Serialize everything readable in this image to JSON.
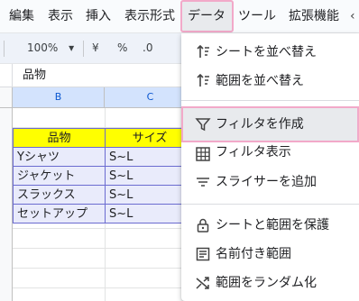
{
  "menubar": {
    "items": [
      "編集",
      "表示",
      "挿入",
      "表示形式",
      "データ",
      "ツール",
      "拡張機能"
    ],
    "active": "データ"
  },
  "toolbar": {
    "zoom": "100%",
    "currency": "¥",
    "percent": "%",
    "decimal": ".0"
  },
  "formula_bar": {
    "content": "品物"
  },
  "sheet": {
    "columns": [
      "B",
      "C"
    ],
    "table": {
      "headers": [
        "品物",
        "サイズ"
      ],
      "rows": [
        [
          "Yシャツ",
          "S~L"
        ],
        [
          "ジャケット",
          "S~L"
        ],
        [
          "スラックス",
          "S~L"
        ],
        [
          "セットアップ",
          "S~L"
        ]
      ]
    },
    "colors": {
      "header_fill": "#ffff00",
      "data_fill": "#e9ebfb",
      "border": "#6b6bd0"
    }
  },
  "data_menu": {
    "items": [
      {
        "label": "シートを並べ替え",
        "icon": "sort-icon"
      },
      {
        "label": "範囲を並べ替え",
        "icon": "sort-icon"
      },
      {
        "label": "フィルタを作成",
        "icon": "filter-icon",
        "highlighted": true
      },
      {
        "label": "フィルタ表示",
        "icon": "table-icon"
      },
      {
        "label": "スライサーを追加",
        "icon": "slicer-icon"
      },
      {
        "label": "シートと範囲を保護",
        "icon": "lock-icon"
      },
      {
        "label": "名前付き範囲",
        "icon": "named-range-icon"
      },
      {
        "label": "範囲をランダム化",
        "icon": "shuffle-icon"
      }
    ],
    "highlight_color": "#f2a9c9"
  }
}
